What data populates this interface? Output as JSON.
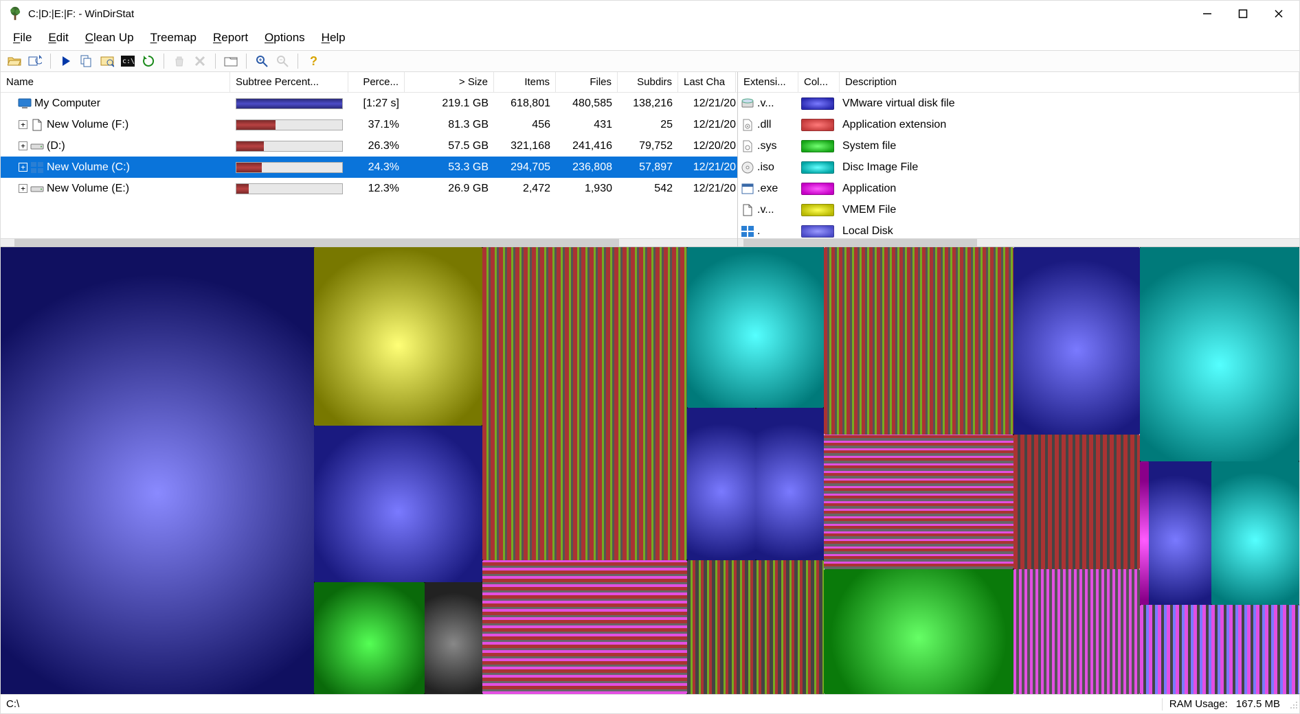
{
  "window": {
    "title": "C:|D:|E:|F: - WinDirStat"
  },
  "menus": {
    "file": "File",
    "edit": "Edit",
    "cleanup": "Clean Up",
    "treemap": "Treemap",
    "report": "Report",
    "options": "Options",
    "help": "Help"
  },
  "dir_headers": {
    "name": "Name",
    "subtree": "Subtree Percent...",
    "percent": "Perce...",
    "size": "> Size",
    "items": "Items",
    "files": "Files",
    "subdirs": "Subdirs",
    "last": "Last Cha"
  },
  "dir_rows": [
    {
      "icon": "computer",
      "name": "My Computer",
      "percent_label": "[1:27 s]",
      "bar_pct": 100,
      "bar_color": "blue",
      "size": "219.1 GB",
      "items": "618,801",
      "files": "480,585",
      "subdirs": "138,216",
      "last": "12/21/20",
      "expandable": false,
      "indent": 0,
      "selected": false
    },
    {
      "icon": "file",
      "name": "New Volume (F:)",
      "percent_label": "37.1%",
      "bar_pct": 37,
      "bar_color": "red",
      "size": "81.3 GB",
      "items": "456",
      "files": "431",
      "subdirs": "25",
      "last": "12/21/20",
      "expandable": true,
      "indent": 1,
      "selected": false
    },
    {
      "icon": "drive",
      "name": "(D:)",
      "percent_label": "26.3%",
      "bar_pct": 26,
      "bar_color": "red",
      "size": "57.5 GB",
      "items": "321,168",
      "files": "241,416",
      "subdirs": "79,752",
      "last": "12/20/20",
      "expandable": true,
      "indent": 1,
      "selected": false
    },
    {
      "icon": "windrive",
      "name": "New Volume (C:)",
      "percent_label": "24.3%",
      "bar_pct": 24,
      "bar_color": "red",
      "size": "53.3 GB",
      "items": "294,705",
      "files": "236,808",
      "subdirs": "57,897",
      "last": "12/21/20",
      "expandable": true,
      "indent": 1,
      "selected": true
    },
    {
      "icon": "drive",
      "name": "New Volume (E:)",
      "percent_label": "12.3%",
      "bar_pct": 12,
      "bar_color": "red",
      "size": "26.9 GB",
      "items": "2,472",
      "files": "1,930",
      "subdirs": "542",
      "last": "12/21/20",
      "expandable": true,
      "indent": 1,
      "selected": false
    }
  ],
  "ext_headers": {
    "ext": "Extensi...",
    "color": "Col...",
    "desc": "Description"
  },
  "ext_rows": [
    {
      "icon": "vmdk",
      "ext": ".v...",
      "c1": "#2a2ab0",
      "c2": "#7a7aff",
      "desc": "VMware virtual disk file"
    },
    {
      "icon": "dll",
      "ext": ".dll",
      "c1": "#c23a3a",
      "c2": "#ff7a7a",
      "desc": "Application extension"
    },
    {
      "icon": "sys",
      "ext": ".sys",
      "c1": "#17a517",
      "c2": "#72ff72",
      "desc": "System file"
    },
    {
      "icon": "iso",
      "ext": ".iso",
      "c1": "#00a5a5",
      "c2": "#66ffff",
      "desc": "Disc Image File"
    },
    {
      "icon": "exe",
      "ext": ".exe",
      "c1": "#c400c4",
      "c2": "#ff5cff",
      "desc": "Application"
    },
    {
      "icon": "file",
      "ext": ".v...",
      "c1": "#b8b800",
      "c2": "#ffff55",
      "desc": "VMEM File"
    },
    {
      "icon": "windrive",
      "ext": ".",
      "c1": "#4a4ac8",
      "c2": "#9a9aff",
      "desc": "Local Disk"
    }
  ],
  "status": {
    "path": "C:\\",
    "ram_label": "RAM Usage:",
    "ram_value": "167.5 MB"
  }
}
